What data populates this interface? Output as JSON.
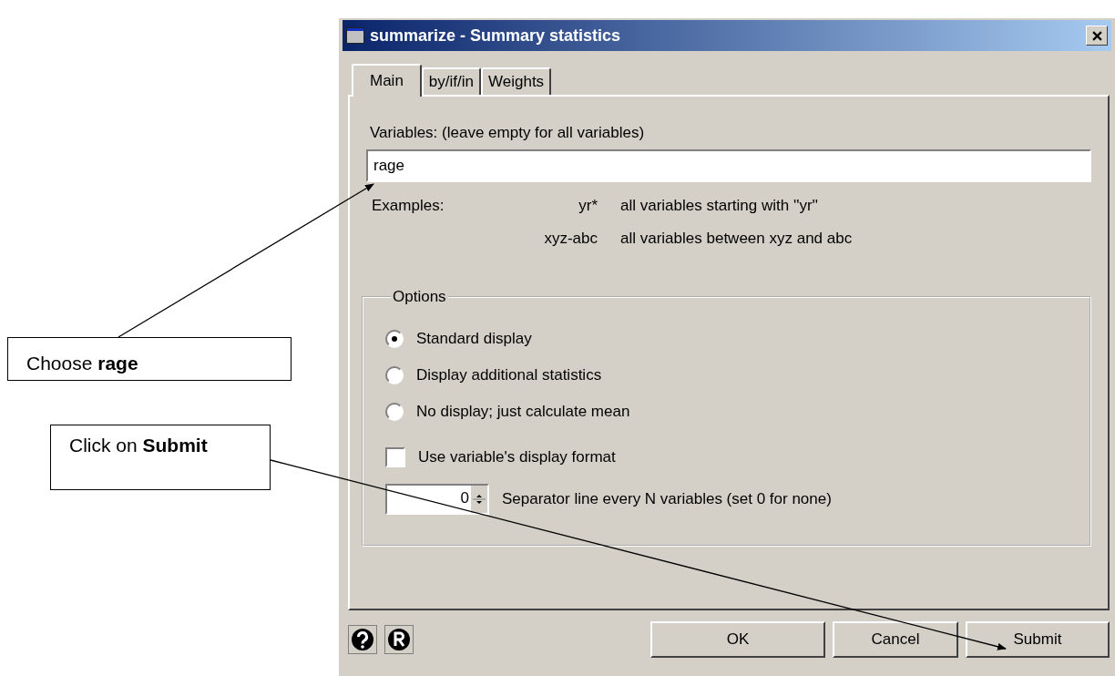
{
  "window": {
    "title": "summarize - Summary statistics"
  },
  "tabs": [
    {
      "label": "Main",
      "selected": true
    },
    {
      "label": "by/if/in",
      "selected": false
    },
    {
      "label": "Weights",
      "selected": false
    }
  ],
  "variables": {
    "label": "Variables: (leave empty for all variables)",
    "value": "rage"
  },
  "examples": {
    "label": "Examples:",
    "rows": [
      {
        "pattern": "yr*",
        "description": "all variables starting with ''yr''"
      },
      {
        "pattern": "xyz-abc",
        "description": "all variables between xyz and abc"
      }
    ]
  },
  "options": {
    "title": "Options",
    "radios": [
      {
        "label": "Standard display",
        "selected": true
      },
      {
        "label": "Display additional statistics",
        "selected": false
      },
      {
        "label": "No display; just calculate mean",
        "selected": false
      }
    ],
    "checkbox": {
      "label": "Use variable's display format",
      "checked": false
    },
    "separator": {
      "value": "0",
      "label": "Separator line every N variables (set 0 for none)"
    }
  },
  "buttons": [
    "OK",
    "Cancel",
    "Submit"
  ],
  "callouts": [
    {
      "text": "Choose **rage**"
    },
    {
      "text": "Click on **Submit**"
    }
  ]
}
